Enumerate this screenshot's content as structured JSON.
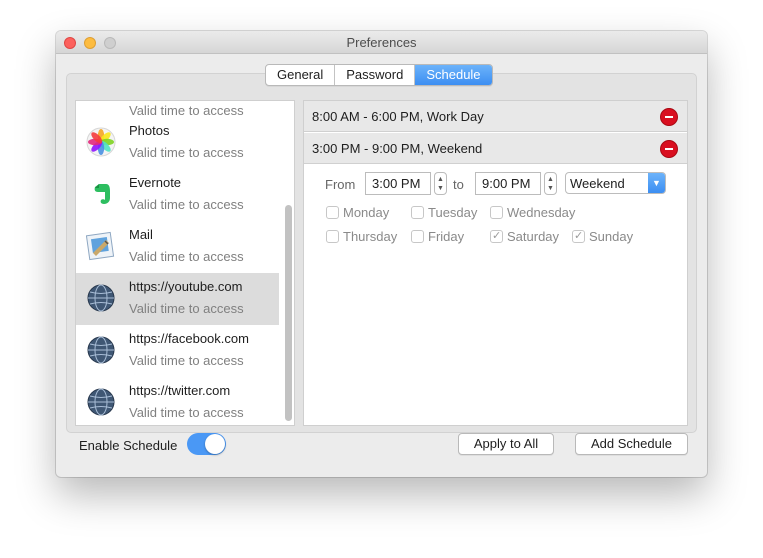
{
  "window": {
    "title": "Preferences"
  },
  "tabs": [
    {
      "label": "General",
      "active": false
    },
    {
      "label": "Password",
      "active": false
    },
    {
      "label": "Schedule",
      "active": true
    }
  ],
  "sidebar": {
    "items": [
      {
        "name": "",
        "sub": "Valid time to access",
        "icon": "app-icon"
      },
      {
        "name": "Photos",
        "sub": "Valid time to access",
        "icon": "photos-icon"
      },
      {
        "name": "Evernote",
        "sub": "Valid time to access",
        "icon": "evernote-icon"
      },
      {
        "name": "Mail",
        "sub": "Valid time to access",
        "icon": "mail-icon"
      },
      {
        "name": "https://youtube.com",
        "sub": "Valid time to access",
        "icon": "globe-icon",
        "selected": true
      },
      {
        "name": "https://facebook.com",
        "sub": "Valid time to access",
        "icon": "globe-icon"
      },
      {
        "name": "https://twitter.com",
        "sub": "Valid time to access",
        "icon": "globe-icon"
      }
    ]
  },
  "schedules": [
    {
      "label": "8:00 AM - 6:00 PM, Work Day"
    },
    {
      "label": "3:00 PM - 9:00 PM, Weekend"
    }
  ],
  "editor": {
    "from_label": "From",
    "from_value": "3:00 PM",
    "to_label": "to",
    "to_value": "9:00 PM",
    "preset": "Weekend",
    "days": [
      {
        "label": "Monday",
        "checked": false
      },
      {
        "label": "Tuesday",
        "checked": false
      },
      {
        "label": "Wednesday",
        "checked": false
      },
      {
        "label": "Thursday",
        "checked": false
      },
      {
        "label": "Friday",
        "checked": false
      },
      {
        "label": "Saturday",
        "checked": true
      },
      {
        "label": "Sunday",
        "checked": true
      }
    ]
  },
  "footer": {
    "enable_label": "Enable Schedule",
    "enable_on": true,
    "apply_all_label": "Apply to All",
    "add_schedule_label": "Add Schedule"
  },
  "colors": {
    "accent": "#3c8ef2",
    "remove": "#d90f20",
    "toggle_on": "#4a98f5"
  }
}
